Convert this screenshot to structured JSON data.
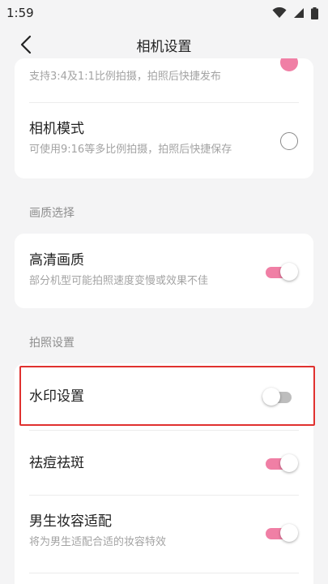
{
  "status_bar": {
    "time": "1:59"
  },
  "header": {
    "title": "相机设置"
  },
  "card_top": {
    "partial_row": {
      "desc": "支持3:4及1:1比例拍摄，拍照后快捷发布"
    },
    "camera_mode": {
      "title": "相机模式",
      "desc": "可使用9:16等多比例拍摄，拍照后快捷保存"
    }
  },
  "section_quality": {
    "label": "画质选择"
  },
  "hd_quality": {
    "title": "高清画质",
    "desc": "部分机型可能拍照速度变慢或效果不佳",
    "enabled": true
  },
  "section_photo": {
    "label": "拍照设置"
  },
  "watermark": {
    "title": "水印设置",
    "enabled": false
  },
  "acne_removal": {
    "title": "祛痘祛斑",
    "enabled": true
  },
  "male_makeup": {
    "title": "男生妆容适配",
    "desc": "将为男生适配合适的妆容特效",
    "enabled": true
  },
  "colors": {
    "accent": "#f07fa5",
    "highlight": "#e0312f",
    "background": "#f4f4f5"
  }
}
